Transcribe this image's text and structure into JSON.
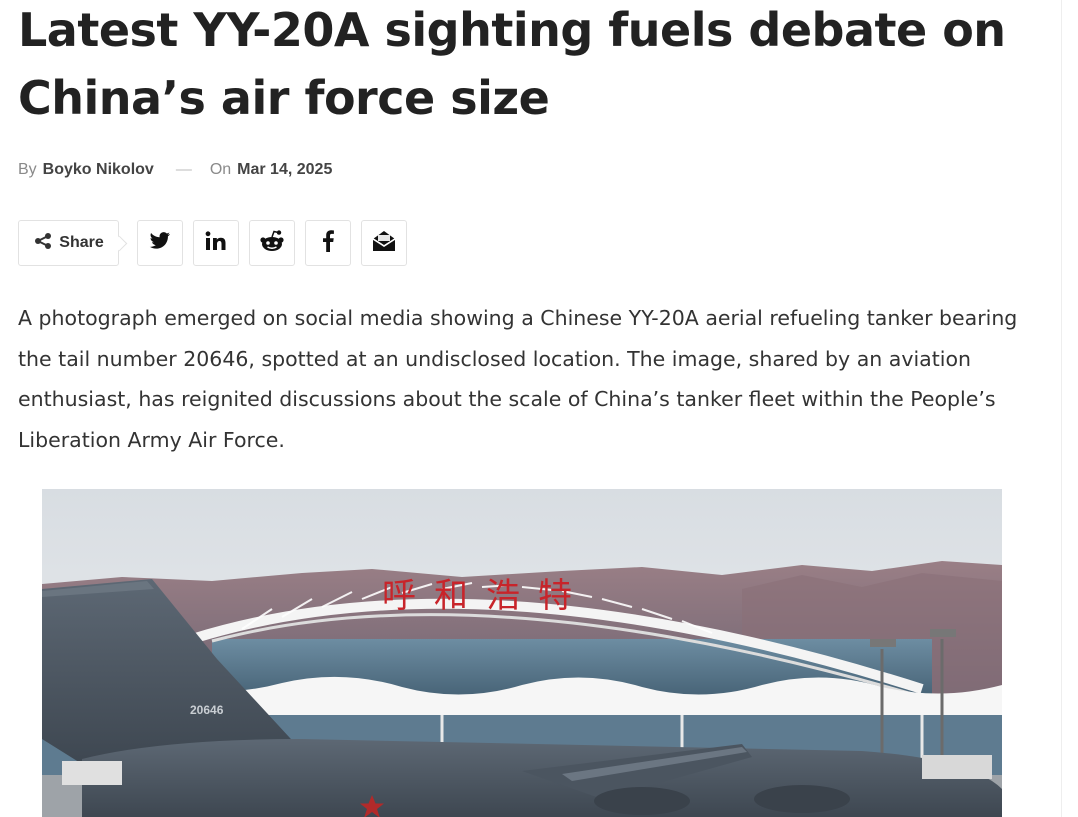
{
  "article": {
    "title": "Latest YY-20A sighting fuels debate on China’s air force size",
    "byline": {
      "by_label": "By",
      "author": "Boyko Nikolov",
      "separator": "—",
      "on_label": "On",
      "date": "Mar 14, 2025"
    },
    "share": {
      "label": "Share",
      "buttons": [
        {
          "icon": "twitter-icon",
          "name": "Twitter"
        },
        {
          "icon": "linkedin-icon",
          "name": "LinkedIn"
        },
        {
          "icon": "reddit-icon",
          "name": "Reddit"
        },
        {
          "icon": "facebook-icon",
          "name": "Facebook"
        },
        {
          "icon": "email-icon",
          "name": "Email"
        }
      ]
    },
    "paragraph": "A photograph emerged on social media showing a Chinese YY-20A aerial refueling tanker bearing the tail number 20646, spotted at an undisclosed location. The image, shared by an aviation enthusiast, has reignited discussions about the scale of China’s tanker fleet within the People’s Liberation Army Air Force.",
    "image": {
      "terminal_sign": "呼和浩特",
      "tail_number": "20646"
    }
  },
  "colors": {
    "text": "#333333",
    "title": "#222222",
    "muted": "#8a8a8a",
    "border": "#e2e2e2",
    "aircraft": "#4f5a66"
  }
}
